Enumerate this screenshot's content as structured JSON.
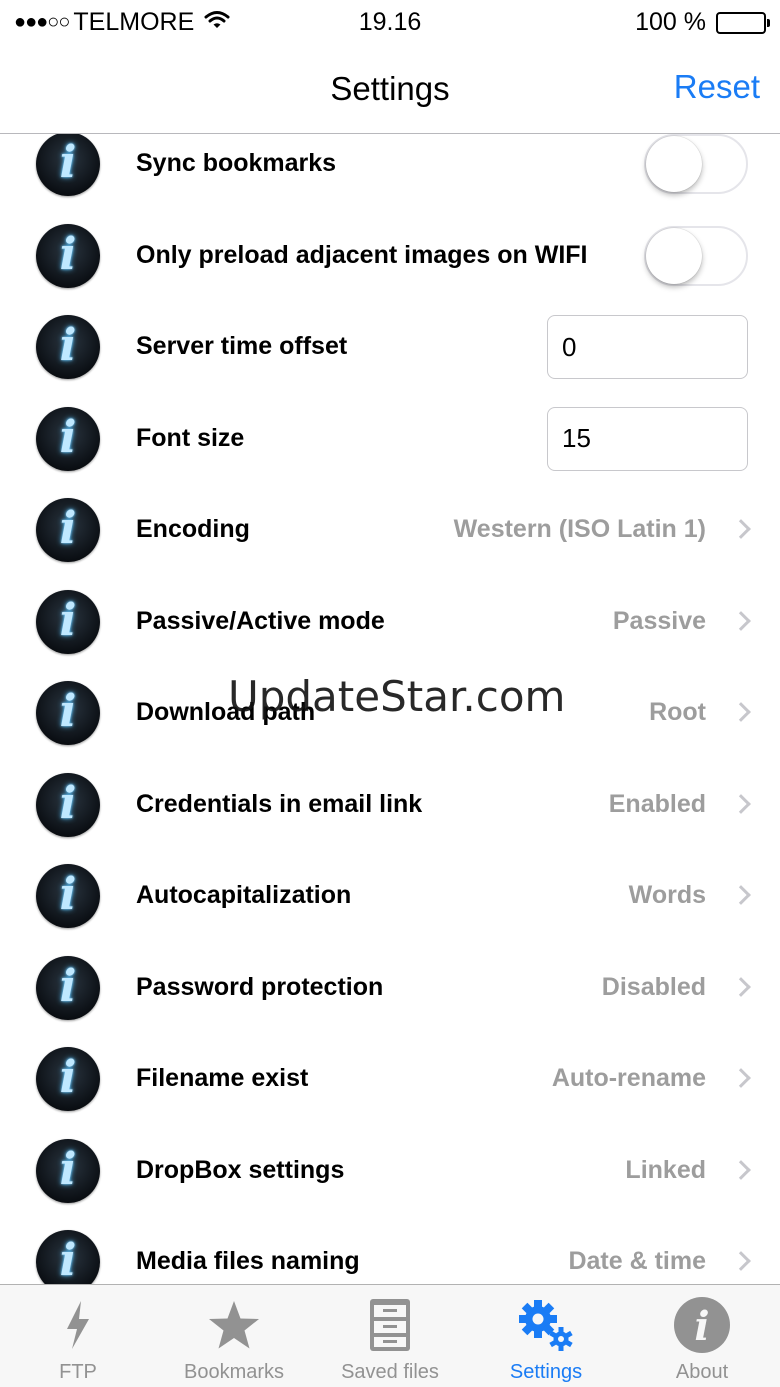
{
  "status_bar": {
    "signal": "●●●○○",
    "carrier": "TELMORE",
    "time": "19.16",
    "battery": "100 %"
  },
  "nav": {
    "title": "Settings",
    "reset_label": "Reset"
  },
  "rows": [
    {
      "label": "Sync bookmarks",
      "type": "toggle",
      "on": false
    },
    {
      "label": "Only preload adjacent images on WIFI",
      "type": "toggle",
      "on": false
    },
    {
      "label": "Server time offset",
      "type": "field",
      "value": "0"
    },
    {
      "label": "Font size",
      "type": "field",
      "value": "15"
    },
    {
      "label": "Encoding",
      "type": "disclosure",
      "value": "Western (ISO Latin 1)"
    },
    {
      "label": "Passive/Active mode",
      "type": "disclosure",
      "value": "Passive"
    },
    {
      "label": "Download path",
      "type": "disclosure",
      "value": "Root"
    },
    {
      "label": "Credentials in email link",
      "type": "disclosure",
      "value": "Enabled"
    },
    {
      "label": "Autocapitalization",
      "type": "disclosure",
      "value": "Words"
    },
    {
      "label": "Password protection",
      "type": "disclosure",
      "value": "Disabled"
    },
    {
      "label": "Filename exist",
      "type": "disclosure",
      "value": "Auto-rename"
    },
    {
      "label": "DropBox settings",
      "type": "disclosure",
      "value": "Linked"
    },
    {
      "label": "Media files naming",
      "type": "disclosure",
      "value": "Date & time"
    }
  ],
  "watermark": "UpdateStar.com",
  "tabs": [
    {
      "label": "FTP",
      "icon": "lightning-icon",
      "active": false
    },
    {
      "label": "Bookmarks",
      "icon": "star-icon",
      "active": false
    },
    {
      "label": "Saved files",
      "icon": "file-cabinet-icon",
      "active": false
    },
    {
      "label": "Settings",
      "icon": "gears-icon",
      "active": true
    },
    {
      "label": "About",
      "icon": "info-icon",
      "active": false
    }
  ],
  "colors": {
    "accent": "#1a7cf5",
    "value_gray": "#9d9d9d",
    "tab_inactive": "#929292"
  }
}
